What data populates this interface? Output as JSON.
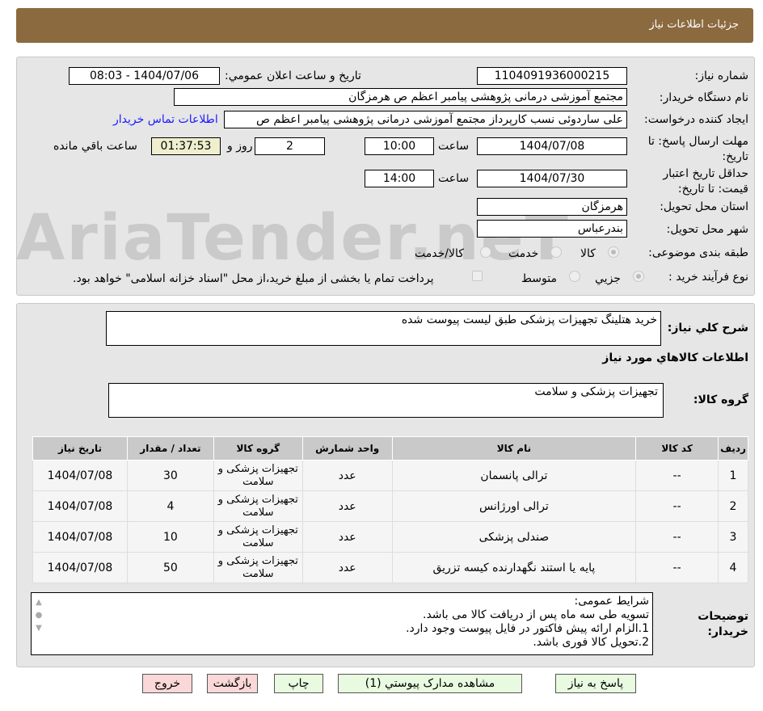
{
  "header": {
    "title": "جزئیات اطلاعات نیاز"
  },
  "form": {
    "need_no_label": "شماره نیاز:",
    "need_no": "1104091936000215",
    "announce_label": "تاريخ و ساعت اعلان عمومي:",
    "announce": "1404/07/06 - 08:03",
    "buyer_label": "نام دستگاه خریدار:",
    "buyer": "مجتمع آموزشی درمانی پژوهشی پیامبر اعظم ص  هرمزگان",
    "creator_label": "ایجاد کننده درخواست:",
    "creator": "علی ساردوئی نسب کارپرداز مجتمع آموزشی درمانی پژوهشی پیامبر اعظم ص",
    "contact_link": "اطلاعات تماس خریدار",
    "deadline_label": "مهلت ارسال پاسخ: تا تاریخ:",
    "deadline_date": "1404/07/08",
    "time_label": "ساعت",
    "deadline_time": "10:00",
    "days": "2",
    "days_label": "روز و",
    "remaining": "01:37:53",
    "remaining_label": "ساعت باقي مانده",
    "validity_label": "حداقل تاریخ اعتبار قیمت: تا تاریخ:",
    "validity_date": "1404/07/30",
    "validity_time": "14:00",
    "province_label": "استان محل تحویل:",
    "province": "هرمزگان",
    "city_label": "شهر محل تحویل:",
    "city": "بندرعباس",
    "category_label": "طبقه بندی موضوعی:",
    "cat_options": [
      "کالا",
      "خدمت",
      "کالا/خدمت"
    ],
    "process_label": "نوع فرآیند خرید :",
    "proc_options": [
      "جزيي",
      "متوسط"
    ],
    "payment_note": "پرداخت تمام یا بخشی از مبلغ خرید،از محل \"اسناد خزانه اسلامی\" خواهد بود."
  },
  "watermark": "AriaTender.neT",
  "details": {
    "desc_label": "شرح کلي نیاز:",
    "desc": "خرید هتلینگ تجهیزات پزشکی طبق لیست پیوست شده",
    "goods_title": "اطلاعات کالاهاي مورد نیاز",
    "group_label": "گروه کالا:",
    "group": "تجهیزات پزشکی و سلامت",
    "columns": [
      "ردیف",
      "کد کالا",
      "نام کالا",
      "واحد شمارش",
      "گروه کالا",
      "تعداد / مقدار",
      "تاریخ نیاز"
    ],
    "rows": [
      [
        "1",
        "--",
        "ترالی پانسمان",
        "عدد",
        "تجهیزات پزشکی و سلامت",
        "30",
        "1404/07/08"
      ],
      [
        "2",
        "--",
        "ترالی اورژانس",
        "عدد",
        "تجهیزات پزشکی و سلامت",
        "4",
        "1404/07/08"
      ],
      [
        "3",
        "--",
        "صندلی پزشکی",
        "عدد",
        "تجهیزات پزشکی و سلامت",
        "10",
        "1404/07/08"
      ],
      [
        "4",
        "--",
        "پایه یا استند نگهدارنده کیسه تزریق",
        "عدد",
        "تجهیزات پزشکی و سلامت",
        "50",
        "1404/07/08"
      ]
    ],
    "notes_label": "توضیحات خریدار:",
    "notes": [
      "شرایط عمومی:",
      "تسویه طی سه ماه پس از دریافت کالا می باشد.",
      "1.الزام ارائه پیش فاکتور در فایل پیوست وجود دارد.",
      "2.تحویل کالا فوری باشد."
    ]
  },
  "buttons": {
    "reply": "پاسخ به نیاز",
    "docs": "مشاهده مدارک پیوستي (1)",
    "print": "چاپ",
    "back": "بازگشت",
    "exit": "خروج"
  }
}
